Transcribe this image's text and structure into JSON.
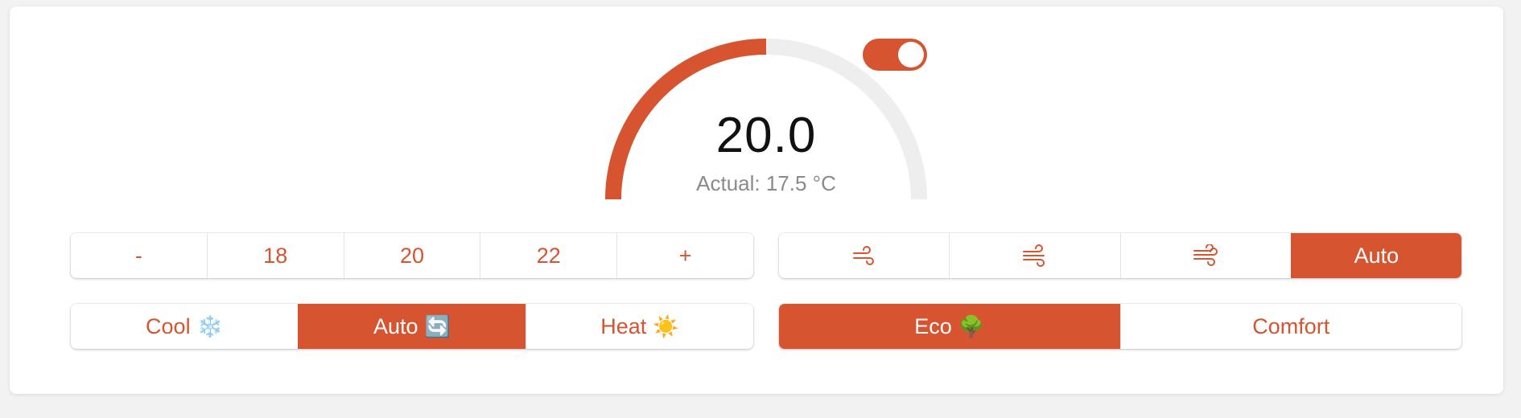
{
  "colors": {
    "accent": "#d6542f",
    "track": "#eeeeee",
    "background": "#f2f2f2",
    "card": "#ffffff"
  },
  "thermostat": {
    "setpoint": "20.0",
    "actual_label": "Actual: 17.5 °C",
    "gauge_fraction": 0.5,
    "power_on": true
  },
  "setpoint_buttons": [
    {
      "label": "-"
    },
    {
      "label": "18"
    },
    {
      "label": "20"
    },
    {
      "label": "22"
    },
    {
      "label": "+"
    }
  ],
  "fan_buttons": [
    {
      "icon": "fan-low-icon",
      "label": ""
    },
    {
      "icon": "fan-medium-icon",
      "label": ""
    },
    {
      "icon": "fan-high-icon",
      "label": ""
    },
    {
      "icon": "",
      "label": "Auto",
      "active": true
    }
  ],
  "mode_buttons": [
    {
      "label": "Cool",
      "emoji": "❄️",
      "icon": "snowflake-icon"
    },
    {
      "label": "Auto",
      "emoji": "🔄",
      "icon": "cycle-icon",
      "active": true
    },
    {
      "label": "Heat",
      "emoji": "☀️",
      "icon": "sun-icon"
    }
  ],
  "preset_buttons": [
    {
      "label": "Eco",
      "emoji": "🌳",
      "icon": "tree-icon",
      "active": true
    },
    {
      "label": "Comfort",
      "emoji": ""
    }
  ]
}
